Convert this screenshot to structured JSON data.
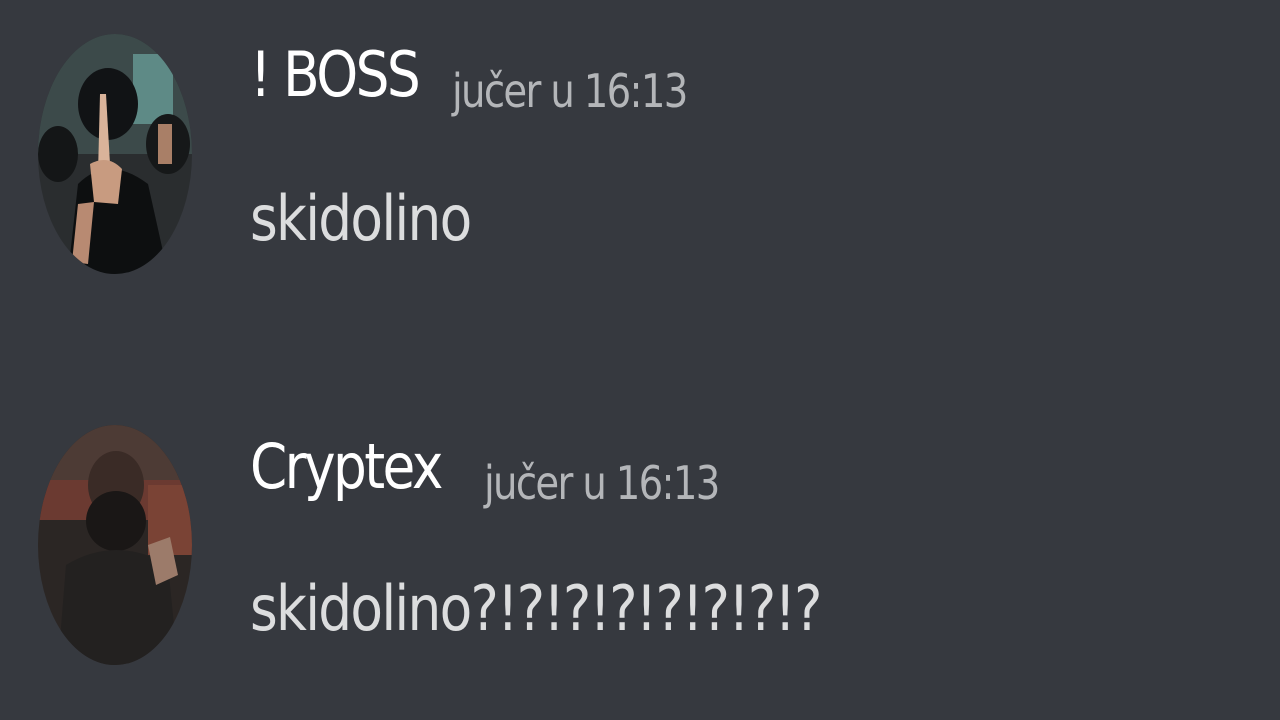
{
  "messages": [
    {
      "username": "! BOSS",
      "timestamp": "jučer u 16:13",
      "text": "skidolino",
      "avatar_icon": "masked-people-avatar"
    },
    {
      "username": "Cryptex",
      "timestamp": "jučer u 16:13",
      "text": "skidolino?!?!?!?!?!?!?!?",
      "avatar_icon": "masked-person-avatar"
    }
  ],
  "colors": {
    "background": "#36393f",
    "username": "#ffffff",
    "timestamp": "#b4b6b9",
    "message_text": "#dcddde"
  }
}
